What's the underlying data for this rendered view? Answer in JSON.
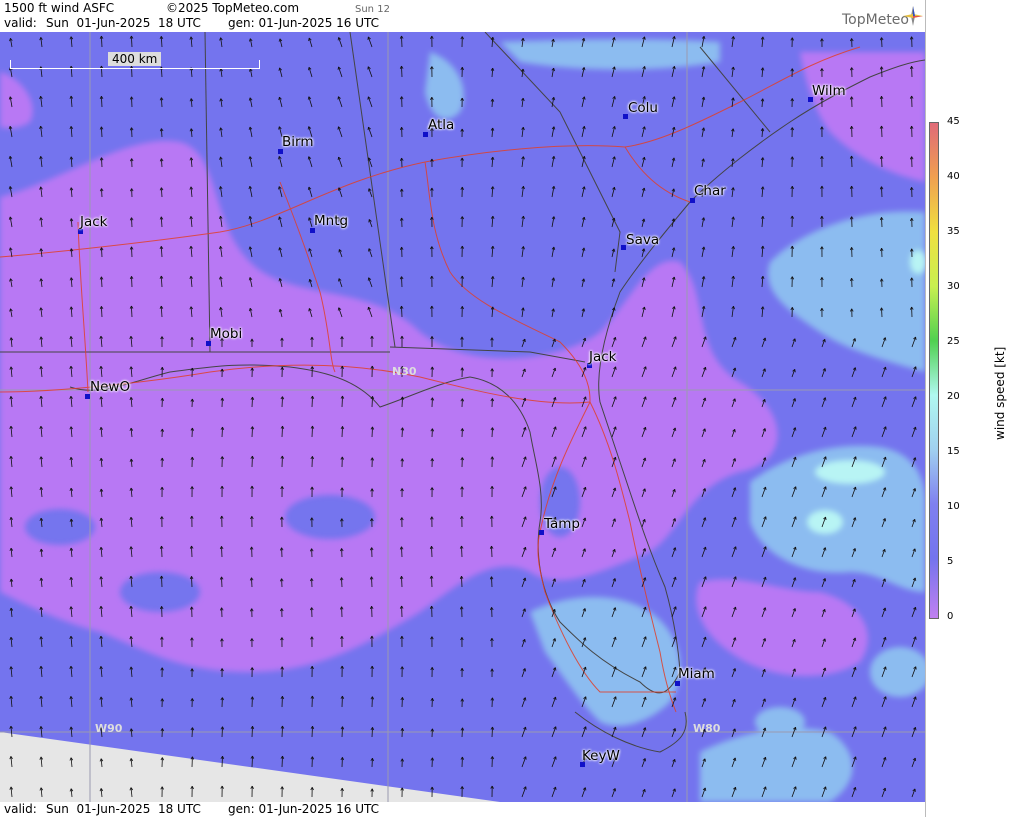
{
  "header": {
    "product": "1500 ft wind ASFC",
    "copyright": "©2025 TopMeteo.com",
    "run": "Sun 12",
    "valid_label": "valid:",
    "valid_value": "Sun  01-Jun-2025  18 UTC",
    "gen": "gen: 01-Jun-2025 16 UTC",
    "logo": "TopMeteo"
  },
  "footer": {
    "valid_label": "valid:",
    "valid_value": "Sun  01-Jun-2025  18 UTC",
    "gen": "gen: 01-Jun-2025 16 UTC"
  },
  "scale": {
    "label": "400 km"
  },
  "grid_labels": {
    "n30": "N30",
    "w90": "W90",
    "w80": "W80"
  },
  "cities": [
    {
      "name": "Birm"
    },
    {
      "name": "Atla"
    },
    {
      "name": "Colu"
    },
    {
      "name": "Wilm"
    },
    {
      "name": "Char"
    },
    {
      "name": "Sava"
    },
    {
      "name": "Jack"
    },
    {
      "name": "Mntg"
    },
    {
      "name": "Mobi"
    },
    {
      "name": "NewO"
    },
    {
      "name": "Jack"
    },
    {
      "name": "Tamp"
    },
    {
      "name": "Miam"
    },
    {
      "name": "KeyW"
    }
  ],
  "colorbar": {
    "title": "wind speed [kt]",
    "ticks": [
      "45",
      "40",
      "35",
      "30",
      "25",
      "20",
      "15",
      "10",
      "5",
      "0"
    ],
    "colors": [
      "#e06a78",
      "#f0a050",
      "#f0e040",
      "#c8f050",
      "#50d050",
      "#b0f8f0",
      "#a0d0f0",
      "#7f80f0",
      "#c080f0"
    ]
  },
  "fields": {
    "background_color": "#7474ee",
    "calm_color": "#b878f4",
    "moderate_color": "#8cbcf0",
    "strong_color": "#b8f4f4",
    "nodata_color": "#e6e6e6"
  }
}
